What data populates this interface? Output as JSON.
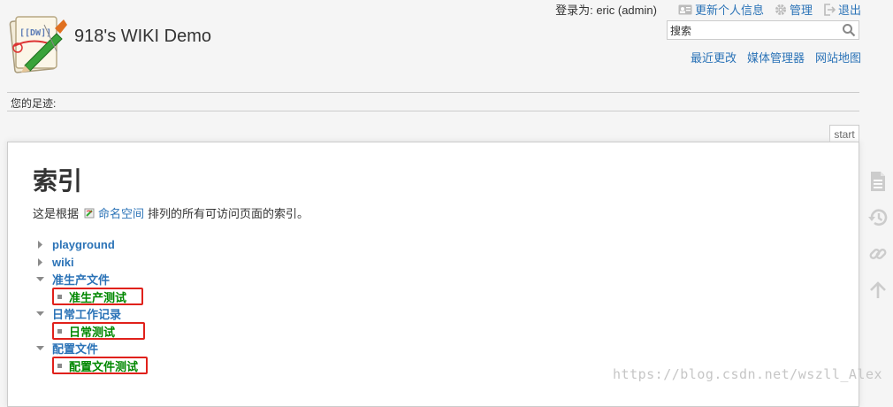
{
  "header": {
    "site_title": "918's WIKI Demo",
    "user_tools": {
      "logged_in_as": "登录为: eric (admin)",
      "update_profile": "更新个人信息",
      "admin": "管理",
      "logout": "退出"
    },
    "search": {
      "value": "搜索",
      "placeholder": "搜索"
    },
    "site_tools": {
      "recent_changes": "最近更改",
      "media_manager": "媒体管理器",
      "sitemap": "网站地图"
    }
  },
  "breadcrumbs": {
    "label": "您的足迹:"
  },
  "page": {
    "tab": "start",
    "title": "索引",
    "intro_prefix": "这是根据",
    "intro_link": "命名空间",
    "intro_suffix": "排列的所有可访问页面的索引。",
    "tree": [
      {
        "label": "playground",
        "expanded": false,
        "children": []
      },
      {
        "label": "wiki",
        "expanded": false,
        "children": []
      },
      {
        "label": "准生产文件",
        "expanded": true,
        "children": [
          {
            "label": "准生产测试",
            "highlighted": true
          }
        ]
      },
      {
        "label": "日常工作记录",
        "expanded": true,
        "children": [
          {
            "label": "日常测试",
            "highlighted": true
          }
        ]
      },
      {
        "label": "配置文件",
        "expanded": true,
        "children": [
          {
            "label": "配置文件测试",
            "highlighted": true
          }
        ]
      }
    ]
  },
  "page_tools": [
    "page-icon",
    "history-icon",
    "backlinks-icon",
    "back-to-top-icon"
  ],
  "watermark": "https://blog.csdn.net/wszll_Alex",
  "colors": {
    "link": "#2b73b7",
    "page_link": "#008800",
    "highlight": "#e0211b"
  }
}
